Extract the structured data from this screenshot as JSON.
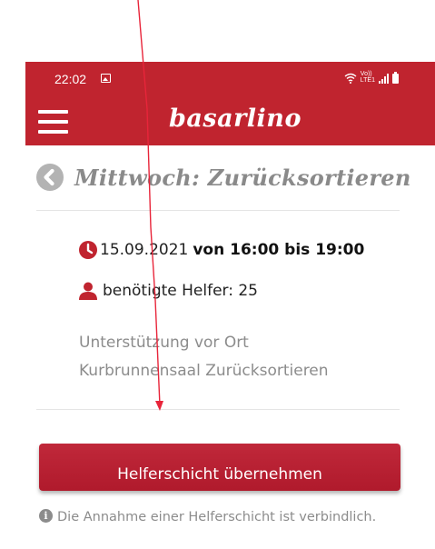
{
  "status_bar": {
    "time": "22:02",
    "volte": "Vo))\nLTE1"
  },
  "header": {
    "brand": "basarlino"
  },
  "page": {
    "title": "Mittwoch: Zurücksortieren"
  },
  "shift": {
    "date": "15.09.2021",
    "time": "von 16:00 bis 19:00",
    "helpers_label": "benötigte Helfer: 25",
    "description_line1": "Unterstützung vor Ort",
    "description_line2": "Kurbrunnensaal Zurücksortieren"
  },
  "actions": {
    "accept_label": "Helferschicht übernehmen"
  },
  "info": {
    "text": "Die Annahme einer Helferschicht ist verbindlich."
  },
  "colors": {
    "brand_red": "#c0242f",
    "icon_red": "#c0242f",
    "muted_gray": "#8c8c8c",
    "annotation_arrow": "#e8253a"
  },
  "icons": {
    "menu": "hamburger-menu-icon",
    "back": "chevron-left-circle-icon",
    "date": "clock-icon",
    "helpers": "person-icon",
    "info": "info-circle-icon"
  }
}
